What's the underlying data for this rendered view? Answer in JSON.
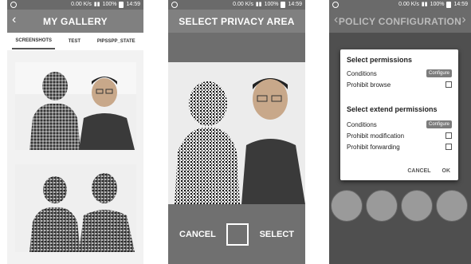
{
  "status": {
    "speed": "0.00 K/s",
    "battery": "100%",
    "time": "14:59"
  },
  "gallery": {
    "title": "MY GALLERY",
    "tabs": [
      "SCREENSHOTS",
      "TEST",
      "PIPSSPP_STATE"
    ]
  },
  "privacy": {
    "title": "SELECT PRIVACY AREA",
    "cancel_label": "CANCEL",
    "select_label": "SELECT"
  },
  "policy": {
    "title": "POLICY CONFIGURATION",
    "dialog": {
      "section1_title": "Select permissions",
      "conditions_label": "Conditions",
      "configure_label": "Configure",
      "prohibit_browse": "Prohibit browse",
      "section2_title": "Select extend permissions",
      "conditions2_label": "Conditions",
      "configure2_label": "Configure",
      "prohibit_modification": "Prohibit modification",
      "prohibit_forwarding": "Prohibit forwarding",
      "cancel_label": "CANCEL",
      "ok_label": "OK"
    }
  }
}
